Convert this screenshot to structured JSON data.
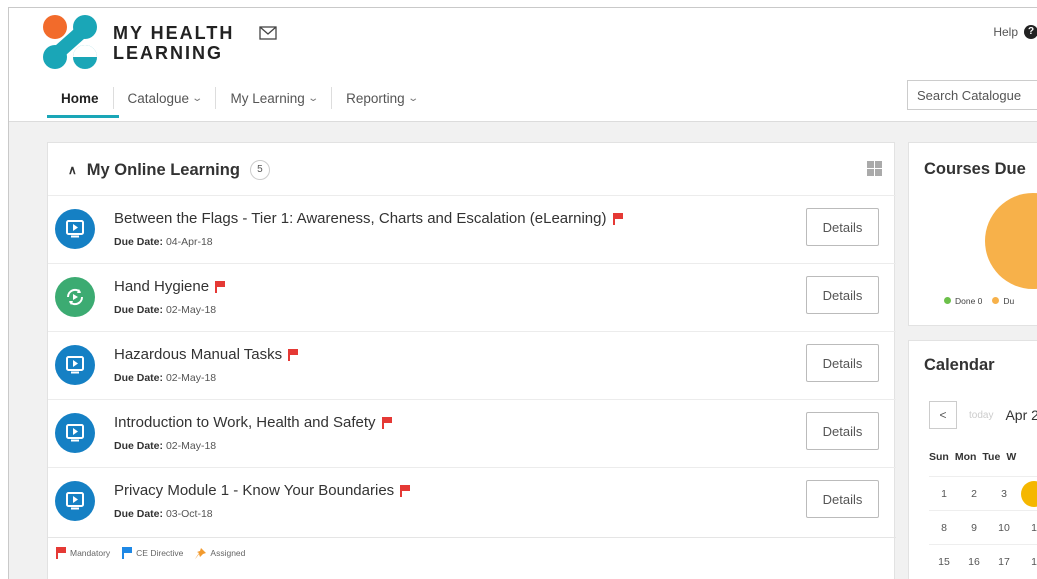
{
  "brand": {
    "line1": "MY HEALTH",
    "line2": "LEARNING"
  },
  "header": {
    "help_label": "Help",
    "help_icon": "?"
  },
  "nav": {
    "items": [
      {
        "label": "Home",
        "active": true
      },
      {
        "label": "Catalogue",
        "dropdown": true
      },
      {
        "label": "My Learning",
        "dropdown": true
      },
      {
        "label": "Reporting",
        "dropdown": true
      }
    ]
  },
  "search": {
    "placeholder": "Search Catalogue"
  },
  "online_learning": {
    "title": "My Online Learning",
    "count": "5",
    "courses": [
      {
        "title": "Between the Flags - Tier 1: Awareness, Charts and Escalation (eLearning)",
        "due_label": "Due Date:",
        "due_date": "04-Apr-18",
        "icon": "play-screen-icon",
        "icon_color": "#1580c4",
        "button": "Details"
      },
      {
        "title": "Hand Hygiene",
        "due_label": "Due Date:",
        "due_date": "02-May-18",
        "icon": "refresh-play-icon",
        "icon_color": "#3cab72",
        "button": "Details"
      },
      {
        "title": "Hazardous Manual Tasks",
        "due_label": "Due Date:",
        "due_date": "02-May-18",
        "icon": "play-screen-icon",
        "icon_color": "#1580c4",
        "button": "Details"
      },
      {
        "title": "Introduction to Work, Health and Safety",
        "due_label": "Due Date:",
        "due_date": "02-May-18",
        "icon": "play-screen-icon",
        "icon_color": "#1580c4",
        "button": "Details"
      },
      {
        "title": "Privacy Module 1 - Know Your Boundaries",
        "due_label": "Due Date:",
        "due_date": "03-Oct-18",
        "icon": "play-screen-icon",
        "icon_color": "#1580c4",
        "button": "Details"
      }
    ],
    "legend": [
      {
        "label": "Mandatory",
        "color": "#e53935"
      },
      {
        "label": "CE Directive",
        "color": "#1e88e5"
      },
      {
        "label": "Assigned",
        "color": "#f29a2e"
      }
    ]
  },
  "courses_due": {
    "title": "Courses Due",
    "legend": [
      {
        "label": "Done 0",
        "color": "#6cc04a"
      },
      {
        "label": "Du",
        "color": "#f7b14a"
      }
    ]
  },
  "calendar": {
    "title": "Calendar",
    "prev": "<",
    "today": "today",
    "month": "Apr 2",
    "days": [
      "Sun",
      "Mon",
      "Tue",
      "W"
    ],
    "weeks": [
      [
        "1",
        "2",
        "3",
        ""
      ],
      [
        "8",
        "9",
        "10",
        "1"
      ],
      [
        "15",
        "16",
        "17",
        "1"
      ]
    ]
  },
  "colors": {
    "accent": "#1aa6b7",
    "logo_orange": "#f26b2b",
    "logo_teal": "#1aa6b7",
    "highlight_day": "#f5b700"
  }
}
